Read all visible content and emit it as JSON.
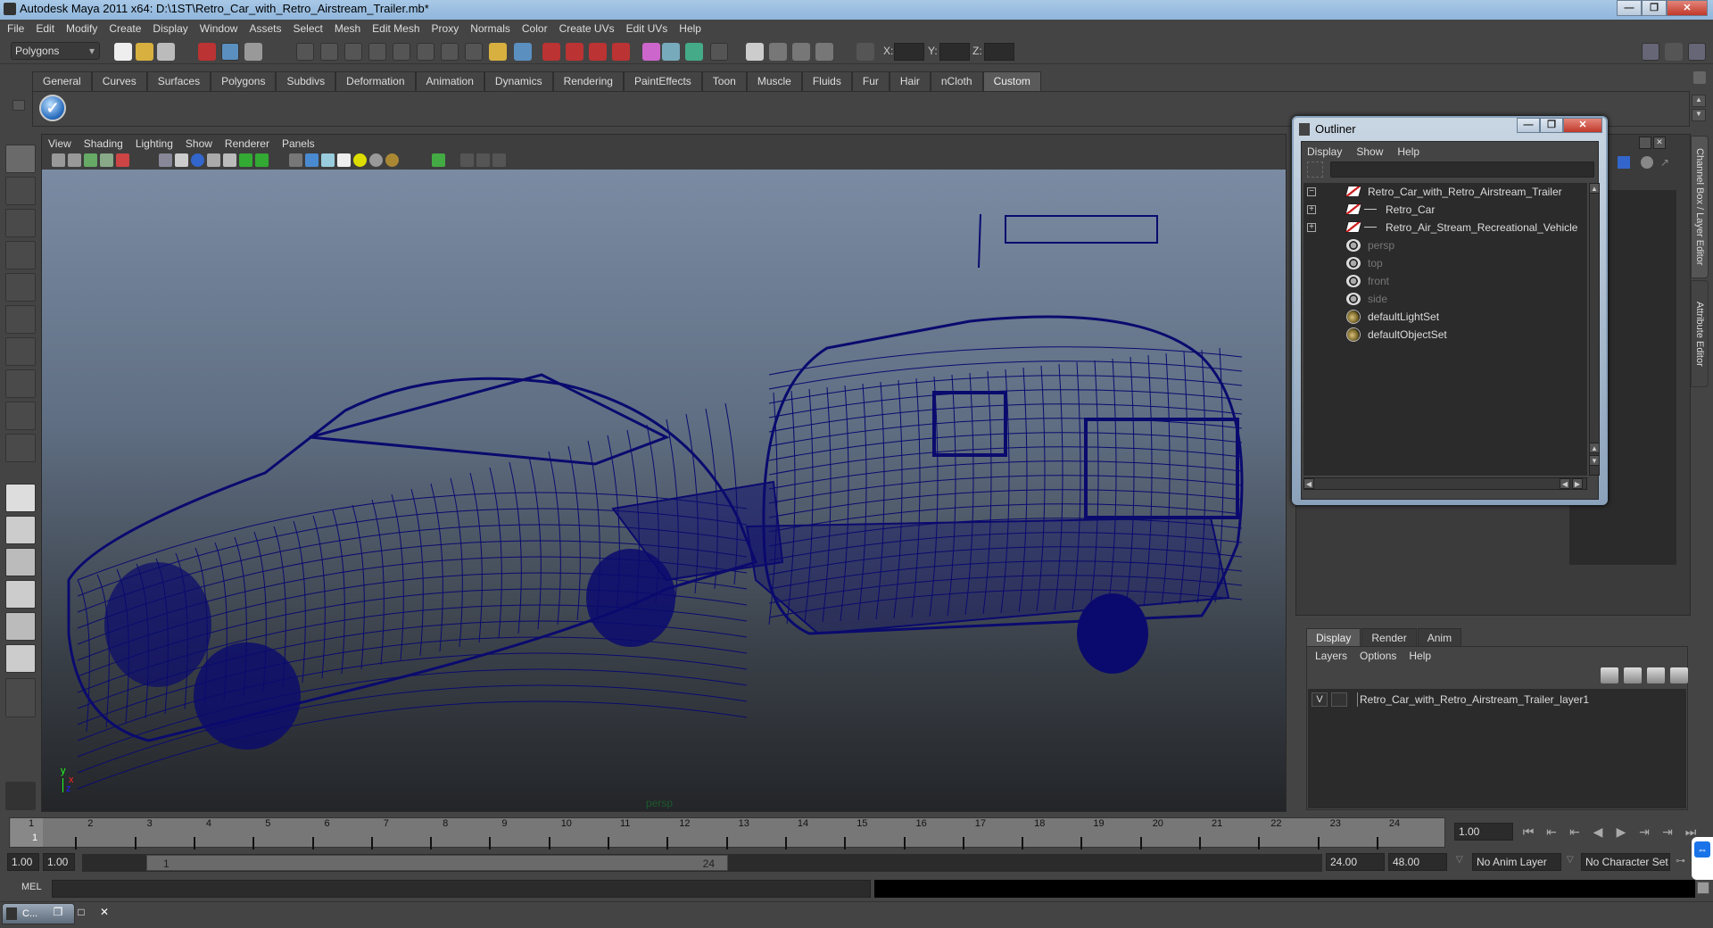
{
  "window": {
    "title": "Autodesk Maya 2011 x64: D:\\1ST\\Retro_Car_with_Retro_Airstream_Trailer.mb*",
    "minimize": "—",
    "restore": "❐",
    "close": "✕"
  },
  "menubar": [
    "File",
    "Edit",
    "Modify",
    "Create",
    "Display",
    "Window",
    "Assets",
    "Select",
    "Mesh",
    "Edit Mesh",
    "Proxy",
    "Normals",
    "Color",
    "Create UVs",
    "Edit UVs",
    "Help"
  ],
  "toolbar": {
    "mode_select": "Polygons",
    "x_label": "X:",
    "y_label": "Y:",
    "z_label": "Z:"
  },
  "shelf": {
    "tabs": [
      "General",
      "Curves",
      "Surfaces",
      "Polygons",
      "Subdivs",
      "Deformation",
      "Animation",
      "Dynamics",
      "Rendering",
      "PaintEffects",
      "Toon",
      "Muscle",
      "Fluids",
      "Fur",
      "Hair",
      "nCloth",
      "Custom"
    ],
    "active_tab": "Custom",
    "check_icon": "✓"
  },
  "viewport": {
    "menu": [
      "View",
      "Shading",
      "Lighting",
      "Show",
      "Renderer",
      "Panels"
    ],
    "camera_label": "persp",
    "axis": {
      "y": "y",
      "x": "x",
      "z": "z"
    },
    "wire_color": "#0a0a6e"
  },
  "outliner": {
    "title": "Outliner",
    "menu": [
      "Display",
      "Show",
      "Help"
    ],
    "items": [
      {
        "label": "Retro_Car_with_Retro_Airstream_Trailer",
        "type": "transform",
        "expander": "−",
        "dim": false
      },
      {
        "label": "Retro_Car",
        "type": "transform",
        "expander": "+",
        "dim": false
      },
      {
        "label": "Retro_Air_Stream_Recreational_Vehicle",
        "type": "transform",
        "expander": "+",
        "dim": false
      },
      {
        "label": "persp",
        "type": "camera",
        "dim": true
      },
      {
        "label": "top",
        "type": "camera",
        "dim": true
      },
      {
        "label": "front",
        "type": "camera",
        "dim": true
      },
      {
        "label": "side",
        "type": "camera",
        "dim": true
      },
      {
        "label": "defaultLightSet",
        "type": "set",
        "dim": false
      },
      {
        "label": "defaultObjectSet",
        "type": "set",
        "dim": false
      }
    ]
  },
  "side_tabs": [
    "Channel Box / Layer Editor",
    "Attribute Editor"
  ],
  "layer_editor": {
    "tabs": [
      "Display",
      "Render",
      "Anim"
    ],
    "active_tab": "Display",
    "menu": [
      "Layers",
      "Options",
      "Help"
    ],
    "layers": [
      {
        "visible": "V",
        "name": "Retro_Car_with_Retro_Airstream_Trailer_layer1"
      }
    ]
  },
  "timeline": {
    "frames": [
      "1",
      "2",
      "3",
      "4",
      "5",
      "6",
      "7",
      "8",
      "9",
      "10",
      "11",
      "12",
      "13",
      "14",
      "15",
      "16",
      "17",
      "18",
      "19",
      "20",
      "21",
      "22",
      "23",
      "24"
    ],
    "current_frame_marker": "1",
    "current_time": "1.00",
    "playback": [
      "⏮",
      "⇤",
      "⇤",
      "◀",
      "▶",
      "⇥",
      "⇥",
      "⏭"
    ]
  },
  "range": {
    "start": "1.00",
    "playback_start": "1.00",
    "slider_start": "1",
    "slider_end": "24",
    "playback_end": "24.00",
    "end": "48.00",
    "anim_layer": "No Anim Layer",
    "character_set": "No Character Set"
  },
  "command_line": {
    "label": "MEL"
  },
  "taskbar": {
    "item": "C..."
  }
}
